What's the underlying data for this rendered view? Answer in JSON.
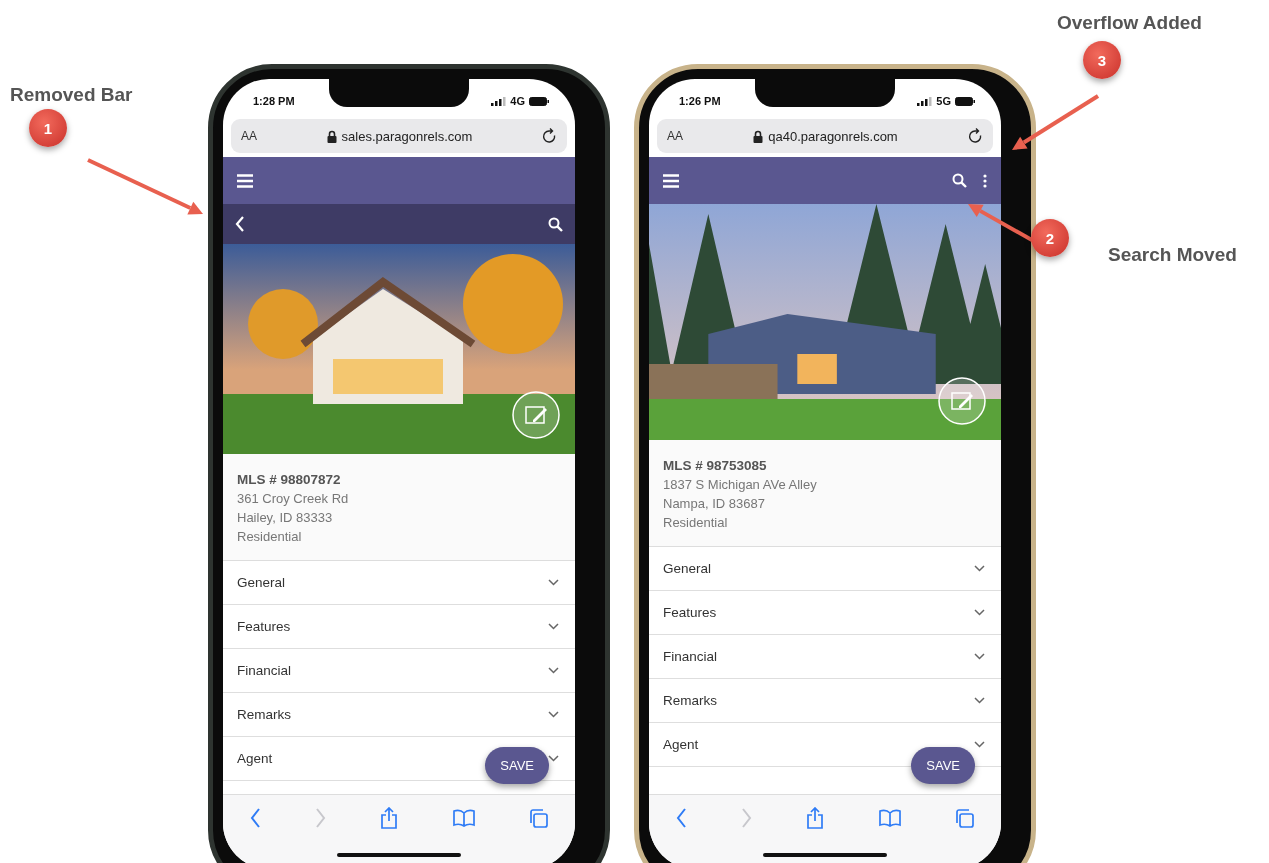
{
  "annotations": [
    {
      "number": "1",
      "label": "Removed Bar"
    },
    {
      "number": "3",
      "label": "Overflow Added"
    },
    {
      "number": "2",
      "label": "Search Moved"
    }
  ],
  "phones": [
    {
      "color": "#2e3430",
      "time": "1:28 PM",
      "network": "4G",
      "url_controls": "AA",
      "url": "sales.paragonrels.com",
      "header_icons": [
        {
          "kind": "menu"
        }
      ],
      "subbar_icons": [
        {
          "kind": "back"
        },
        {
          "kind": "search"
        }
      ],
      "photo": {
        "kind": "autumn"
      },
      "mls": "MLS # 98807872",
      "address": [
        "361 Croy Creek Rd",
        "Hailey, ID 83333"
      ],
      "property_type": "Residential",
      "sections": [
        "General",
        "Features",
        "Financial",
        "Remarks",
        "Agent"
      ],
      "save": "SAVE",
      "toolbar": [
        {
          "kind": "back",
          "disabled": false
        },
        {
          "kind": "forward",
          "disabled": true
        },
        {
          "kind": "share",
          "disabled": false
        },
        {
          "kind": "bookmarks",
          "disabled": false
        },
        {
          "kind": "tabs",
          "disabled": false
        }
      ]
    },
    {
      "color": "#c8b38a",
      "time": "1:26 PM",
      "network": "5G",
      "url_controls": "AA",
      "url": "qa40.paragonrels.com",
      "header_icons": [
        {
          "kind": "menu"
        },
        {
          "kind": "search"
        },
        {
          "kind": "more"
        }
      ],
      "photo": {
        "kind": "forest"
      },
      "mls": "MLS # 98753085",
      "address": [
        "1837 S Michigan AVe Alley",
        "Nampa, ID 83687"
      ],
      "property_type": "Residential",
      "sections": [
        "General",
        "Features",
        "Financial",
        "Remarks",
        "Agent"
      ],
      "save": "SAVE",
      "toolbar": [
        {
          "kind": "back",
          "disabled": false
        },
        {
          "kind": "forward",
          "disabled": true
        },
        {
          "kind": "share",
          "disabled": false
        },
        {
          "kind": "bookmarks",
          "disabled": false
        },
        {
          "kind": "tabs",
          "disabled": false
        }
      ]
    }
  ]
}
